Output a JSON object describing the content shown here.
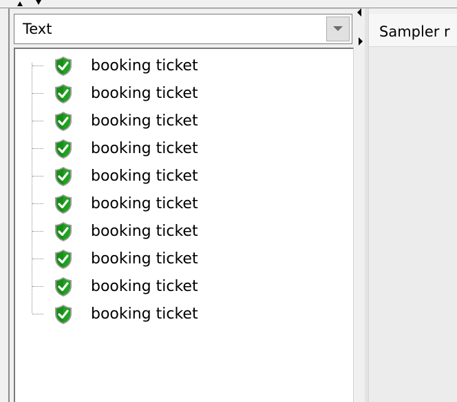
{
  "renderer_combo": {
    "selected": "Text"
  },
  "result_tree": {
    "items": [
      {
        "label": "booking ticket",
        "status": "success"
      },
      {
        "label": "booking ticket",
        "status": "success"
      },
      {
        "label": "booking ticket",
        "status": "success"
      },
      {
        "label": "booking ticket",
        "status": "success"
      },
      {
        "label": "booking ticket",
        "status": "success"
      },
      {
        "label": "booking ticket",
        "status": "success"
      },
      {
        "label": "booking ticket",
        "status": "success"
      },
      {
        "label": "booking ticket",
        "status": "success"
      },
      {
        "label": "booking ticket",
        "status": "success"
      },
      {
        "label": "booking ticket",
        "status": "success"
      }
    ],
    "icon": "green-shield-check-icon"
  },
  "details_panel": {
    "tab_label": "Sampler r"
  },
  "colors": {
    "success_icon": "#1fa21f",
    "success_icon_dark": "#0d6b0d",
    "border": "#7a7a7a",
    "panel_bg": "#f0f0f0"
  }
}
